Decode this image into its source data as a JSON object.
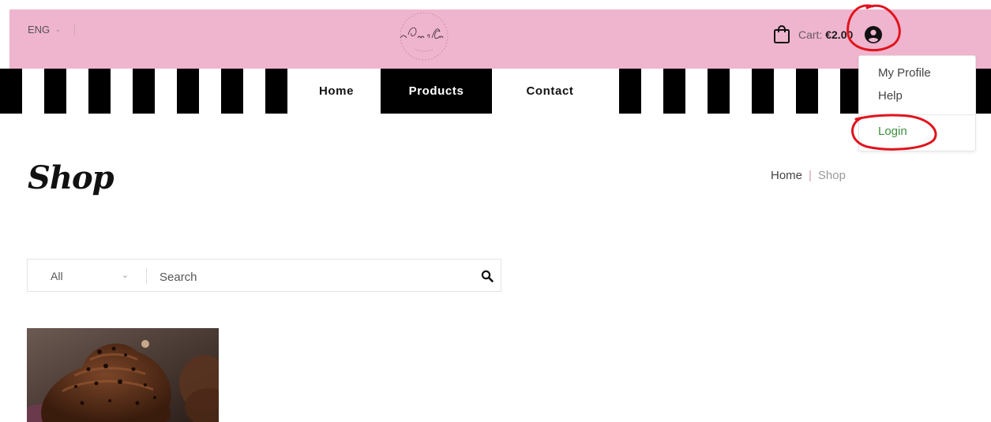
{
  "header": {
    "language": "ENG",
    "cart_label": "Cart:",
    "cart_value": "€2.00",
    "icons": [
      "chevron-down-icon",
      "shopping-bag-icon",
      "user-icon"
    ]
  },
  "nav": {
    "items": [
      {
        "label": "Home"
      },
      {
        "label": "Products",
        "active": true
      },
      {
        "label": "Contact"
      }
    ]
  },
  "user_menu": {
    "items": [
      {
        "label": "My Profile"
      },
      {
        "label": "Help"
      },
      {
        "label": "Login"
      }
    ]
  },
  "page": {
    "title": "Shop",
    "breadcrumb": [
      "Home",
      "Shop"
    ]
  },
  "search": {
    "category": "All",
    "placeholder": "Search",
    "value": ""
  },
  "colors": {
    "header_bg": "#efb4ce",
    "annotation": "#e0141e",
    "login_link": "#3f8f3f"
  }
}
